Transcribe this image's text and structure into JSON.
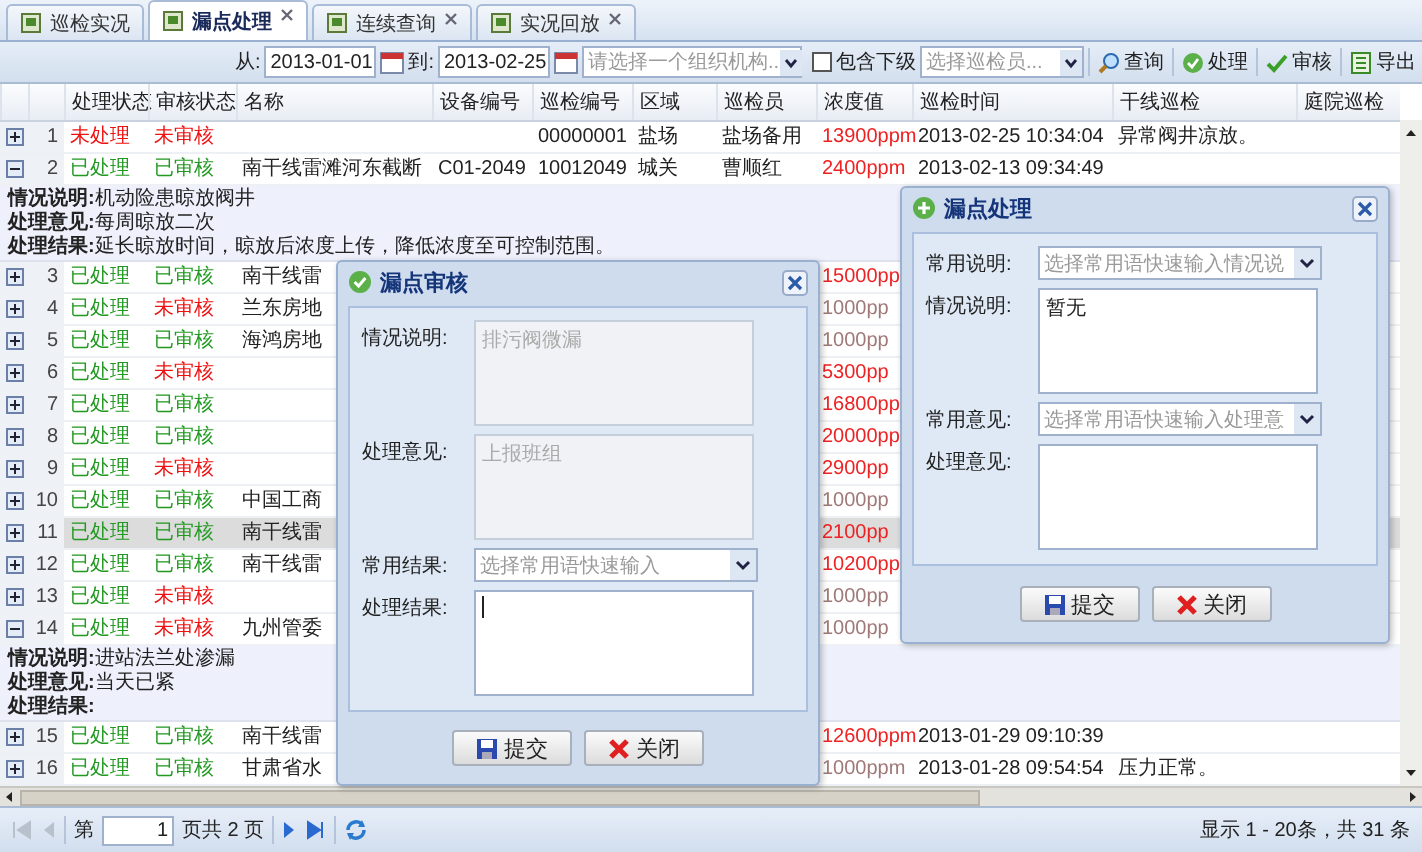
{
  "tabs": [
    {
      "label": "巡检实况",
      "selected": false,
      "closable": false
    },
    {
      "label": "漏点处理",
      "selected": true,
      "closable": true
    },
    {
      "label": "连续查询",
      "selected": false,
      "closable": true
    },
    {
      "label": "实况回放",
      "selected": false,
      "closable": true
    }
  ],
  "toolbar": {
    "from_label": "从:",
    "from_date": "2013-01-01",
    "to_label": "到:",
    "to_date": "2013-02-25",
    "org_placeholder": "请选择一个组织机构..",
    "include_sub": {
      "label": "包含下级",
      "checked": false
    },
    "inspector_placeholder": "选择巡检员...",
    "buttons": [
      {
        "label": "查询",
        "kind": "search"
      },
      {
        "label": "处理",
        "kind": "process"
      },
      {
        "label": "审核",
        "kind": "review"
      },
      {
        "label": "导出",
        "kind": "export"
      }
    ]
  },
  "grid": {
    "columns": [
      "处理状态",
      "审核状态",
      "名称",
      "设备编号",
      "巡检编号",
      "区域",
      "巡检员",
      "浓度值",
      "巡检时间",
      "干线巡检",
      "庭院巡检"
    ],
    "rows": [
      {
        "number": "1",
        "expanded": false,
        "selected": false,
        "process_status": "未处理",
        "processed": false,
        "review_status": "未审核",
        "reviewed": false,
        "patrol_no": "00000001",
        "area": "盐场",
        "inspector": "盐场备用",
        "concentration": "13900ppm",
        "alarm": true,
        "time": "2013-02-25 10:34:04",
        "trunk_patrol": "异常阀井凉放。"
      },
      {
        "number": "2",
        "expanded": true,
        "selected": false,
        "process_status": "已处理",
        "processed": true,
        "review_status": "已审核",
        "reviewed": true,
        "name": "南干线雷滩河东截断",
        "device_no": "C01-2049",
        "patrol_no": "10012049",
        "area": "城关",
        "inspector": "曹顺红",
        "concentration": "2400ppm",
        "alarm": true,
        "time": "2013-02-13 09:34:49",
        "details": [
          "**情况说明:**机动险患晾放阀井",
          "**处理意见:**每周晾放二次",
          "**处理结果:**延长晾放时间，晾放后浓度上传，降低浓度至可控制范围。"
        ]
      },
      {
        "number": "3",
        "expanded": false,
        "selected": false,
        "process_status": "已处理",
        "processed": true,
        "review_status": "已审核",
        "reviewed": true,
        "name": "南干线雷",
        "concentration": "15000pp",
        "alarm": true
      },
      {
        "number": "4",
        "expanded": false,
        "selected": false,
        "process_status": "已处理",
        "processed": true,
        "review_status": "未审核",
        "reviewed": false,
        "name": "兰东房地",
        "concentration": "1000pp",
        "alarm": false
      },
      {
        "number": "5",
        "expanded": false,
        "selected": false,
        "process_status": "已处理",
        "processed": true,
        "review_status": "已审核",
        "reviewed": true,
        "name": "海鸿房地",
        "concentration": "1000pp",
        "alarm": false
      },
      {
        "number": "6",
        "expanded": false,
        "selected": false,
        "process_status": "已处理",
        "processed": true,
        "review_status": "未审核",
        "reviewed": false,
        "concentration": "5300pp",
        "alarm": true
      },
      {
        "number": "7",
        "expanded": false,
        "selected": false,
        "process_status": "已处理",
        "processed": true,
        "review_status": "已审核",
        "reviewed": true,
        "concentration": "16800pp",
        "alarm": true
      },
      {
        "number": "8",
        "expanded": false,
        "selected": false,
        "process_status": "已处理",
        "processed": true,
        "review_status": "已审核",
        "reviewed": true,
        "concentration": "20000pp",
        "alarm": true
      },
      {
        "number": "9",
        "expanded": false,
        "selected": false,
        "process_status": "已处理",
        "processed": true,
        "review_status": "未审核",
        "reviewed": false,
        "concentration": "2900pp",
        "alarm": true
      },
      {
        "number": "10",
        "expanded": false,
        "selected": false,
        "process_status": "已处理",
        "processed": true,
        "review_status": "已审核",
        "reviewed": true,
        "name": "中国工商",
        "concentration": "1000pp",
        "alarm": false
      },
      {
        "number": "11",
        "expanded": false,
        "selected": true,
        "process_status": "已处理",
        "processed": true,
        "review_status": "已审核",
        "reviewed": true,
        "name": "南干线雷",
        "concentration": "2100pp",
        "alarm": true
      },
      {
        "number": "12",
        "expanded": false,
        "selected": false,
        "process_status": "已处理",
        "processed": true,
        "review_status": "已审核",
        "reviewed": true,
        "name": "南干线雷",
        "concentration": "10200pp",
        "alarm": true
      },
      {
        "number": "13",
        "expanded": false,
        "selected": false,
        "process_status": "已处理",
        "processed": true,
        "review_status": "未审核",
        "reviewed": false,
        "concentration": "1000pp",
        "alarm": false
      },
      {
        "number": "14",
        "expanded": true,
        "selected": false,
        "process_status": "已处理",
        "processed": true,
        "review_status": "未审核",
        "reviewed": false,
        "name": "九州管委",
        "concentration": "1000pp",
        "alarm": false,
        "details": [
          "**情况说明:**进站法兰处渗漏",
          "**处理意见:**当天已紧",
          "**处理结果:**"
        ]
      },
      {
        "number": "15",
        "expanded": false,
        "selected": false,
        "process_status": "已处理",
        "processed": true,
        "review_status": "已审核",
        "reviewed": true,
        "name": "南干线雷",
        "concentration": "12600ppm",
        "alarm": true,
        "time": "2013-01-29 09:10:39"
      },
      {
        "number": "16",
        "expanded": false,
        "selected": false,
        "process_status": "已处理",
        "processed": true,
        "review_status": "已审核",
        "reviewed": true,
        "name": "甘肃省水",
        "concentration": "1000ppm",
        "alarm": false,
        "time": "2013-01-28 09:54:54",
        "trunk_patrol": "压力正常。"
      }
    ]
  },
  "pager": {
    "before": "第",
    "page": "1",
    "after": "页共 2 页",
    "summary": "显示 1 - 20条，共 31 条"
  },
  "review_dialog": {
    "title": "漏点审核",
    "fields": [
      {
        "kind": "textarea",
        "label": "情况说明:",
        "value": "排污阀微漏",
        "disabled": true,
        "focused": false
      },
      {
        "kind": "textarea",
        "label": "处理意见:",
        "value": "上报班组",
        "disabled": true,
        "focused": false
      },
      {
        "kind": "combo",
        "label": "常用结果:",
        "placeholder": "选择常用语快速输入"
      },
      {
        "kind": "textarea",
        "label": "处理结果:",
        "disabled": false,
        "focused": true
      }
    ],
    "buttons": [
      {
        "label": "提交",
        "kind": "submit"
      },
      {
        "label": "关闭",
        "kind": "close"
      }
    ]
  },
  "process_dialog": {
    "title": "漏点处理",
    "fields": [
      {
        "kind": "combo",
        "label": "常用说明:",
        "placeholder": "选择常用语快速输入情况说"
      },
      {
        "kind": "textarea",
        "label": "情况说明:",
        "value": "暂无",
        "disabled": false,
        "focused": false
      },
      {
        "kind": "combo",
        "label": "常用意见:",
        "placeholder": "选择常用语快速输入处理意"
      },
      {
        "kind": "textarea",
        "label": "处理意见:",
        "disabled": false,
        "focused": false
      }
    ],
    "buttons": [
      {
        "label": "提交",
        "kind": "submit"
      },
      {
        "label": "关闭",
        "kind": "close"
      }
    ]
  }
}
